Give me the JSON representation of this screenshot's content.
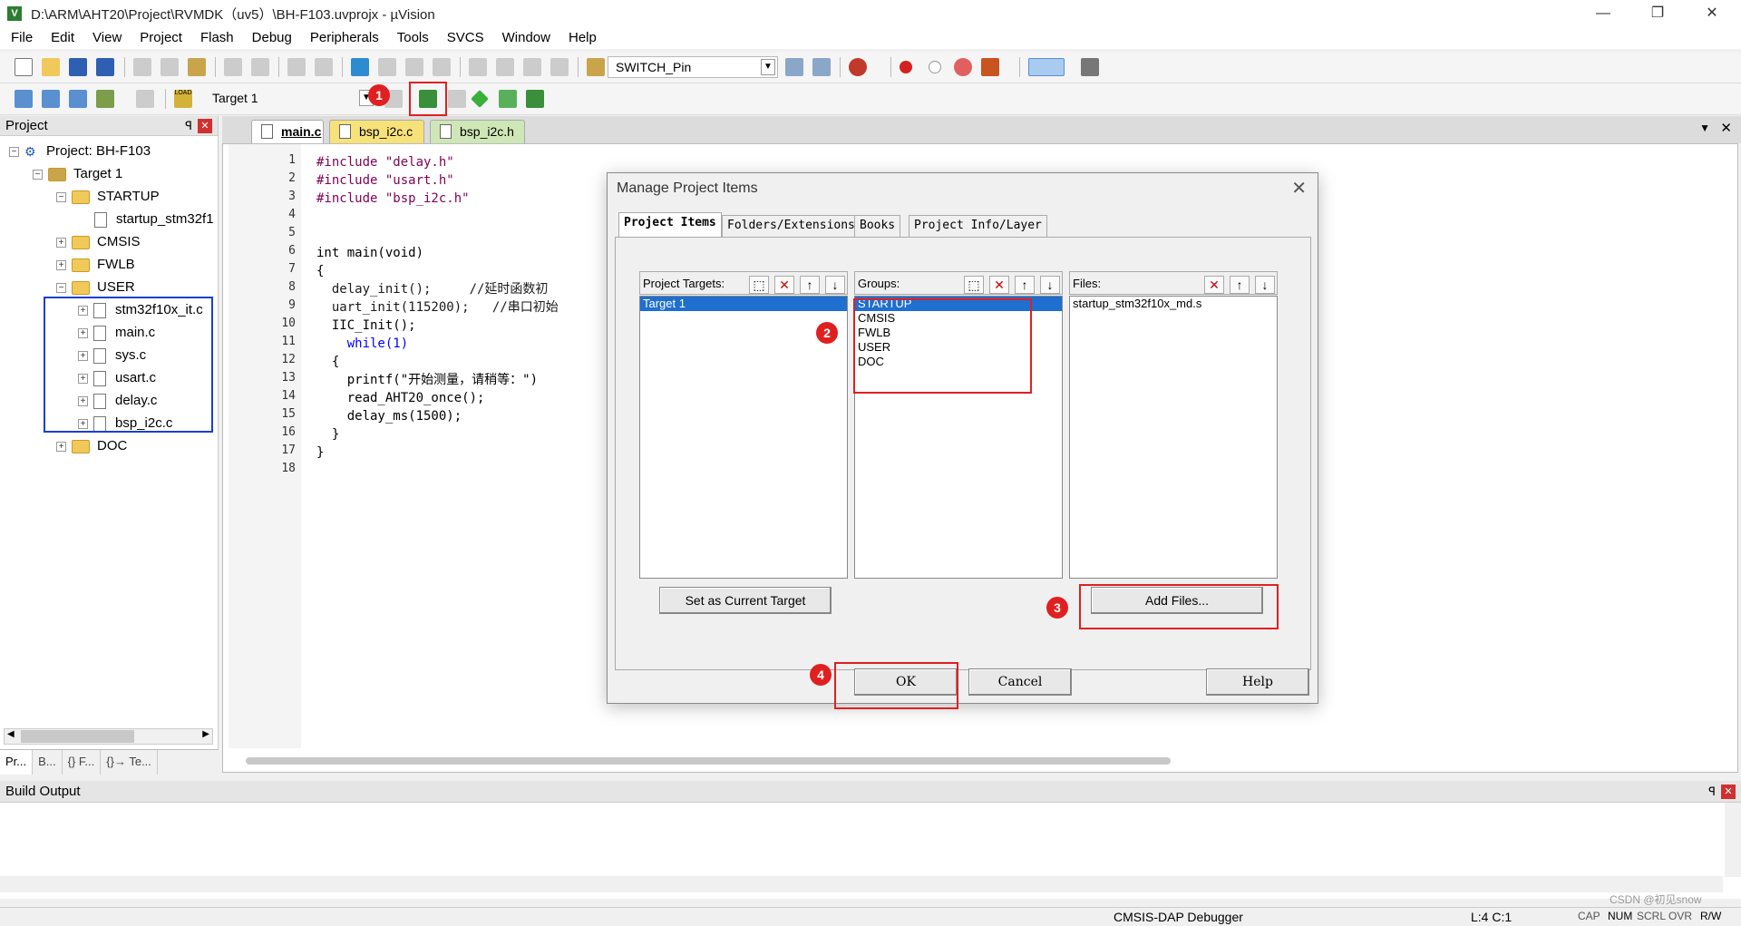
{
  "window": {
    "title": "D:\\ARM\\AHT20\\Project\\RVMDK（uv5）\\BH-F103.uvprojx - µVision",
    "minimize": "—",
    "restore": "❐",
    "close": "✕"
  },
  "menu": [
    "File",
    "Edit",
    "View",
    "Project",
    "Flash",
    "Debug",
    "Peripherals",
    "Tools",
    "SVCS",
    "Window",
    "Help"
  ],
  "toolbar": {
    "find_combo": "SWITCH_Pin",
    "target_combo": "Target 1",
    "load_label": "LOAD"
  },
  "annotations": {
    "n1": "1",
    "n2": "2",
    "n3": "3",
    "n4": "4"
  },
  "project_panel": {
    "title": "Project",
    "pin": "ꟼ",
    "close": "✕",
    "root": "Project: BH-F103",
    "target": "Target 1",
    "groups": [
      {
        "name": "STARTUP",
        "expanded": true,
        "files": [
          "startup_stm32f10x_md.s"
        ]
      },
      {
        "name": "CMSIS",
        "expanded": false
      },
      {
        "name": "FWLB",
        "expanded": false
      },
      {
        "name": "USER",
        "expanded": true,
        "files": [
          "stm32f10x_it.c",
          "main.c",
          "sys.c",
          "usart.c",
          "delay.c",
          "bsp_i2c.c"
        ]
      },
      {
        "name": "DOC",
        "expanded": false
      }
    ],
    "startup_file_visible": "startup_stm32f1",
    "bottom_tabs": [
      "Pr...",
      "B...",
      "{} F...",
      "{}→ Te..."
    ]
  },
  "editor": {
    "tabs": [
      {
        "label": "main.c",
        "color": "#ffffff",
        "active": true
      },
      {
        "label": "bsp_i2c.c",
        "color": "#f7e27a"
      },
      {
        "label": "bsp_i2c.h",
        "color": "#cfe7b6"
      }
    ],
    "line_numbers": [
      "1",
      "2",
      "3",
      "4",
      "5",
      "6",
      "7",
      "8",
      "9",
      "10",
      "11",
      "12",
      "13",
      "14",
      "15",
      "16",
      "17",
      "18"
    ],
    "code_lines": [
      "#include \"delay.h\"",
      "#include \"usart.h\"",
      "#include \"bsp_i2c.h\"",
      "",
      "",
      "int main(void)",
      "{",
      "  delay_init();     //延时函数初",
      "  uart_init(115200);   //串口初始",
      "  IIC_Init();",
      "    while(1)",
      "  {",
      "    printf(\"开始测量，请稍等：\")",
      "    read_AHT20_once();",
      "    delay_ms(1500);",
      "  }",
      "}",
      ""
    ]
  },
  "dialog": {
    "title": "Manage Project Items",
    "close": "✕",
    "tabs": [
      "Project Items",
      "Folders/Extensions",
      "Books",
      "Project Info/Layer"
    ],
    "targets_label": "Project Targets:",
    "targets": [
      "Target 1"
    ],
    "groups_label": "Groups:",
    "groups": [
      "STARTUP",
      "CMSIS",
      "FWLB",
      "USER",
      "DOC"
    ],
    "files_label": "Files:",
    "files": [
      "startup_stm32f10x_md.s"
    ],
    "set_current_target": "Set as Current Target",
    "add_files": "Add Files...",
    "ok": "OK",
    "cancel": "Cancel",
    "help": "Help"
  },
  "build_output": {
    "title": "Build Output"
  },
  "status": {
    "debugger": "CMSIS-DAP Debugger",
    "position": "L:4 C:1",
    "cap": "CAP",
    "num": "NUM",
    "scrl": "SCRL",
    "ovr": "OVR",
    "rw": "R/W",
    "watermark": "CSDN @初见snow"
  }
}
